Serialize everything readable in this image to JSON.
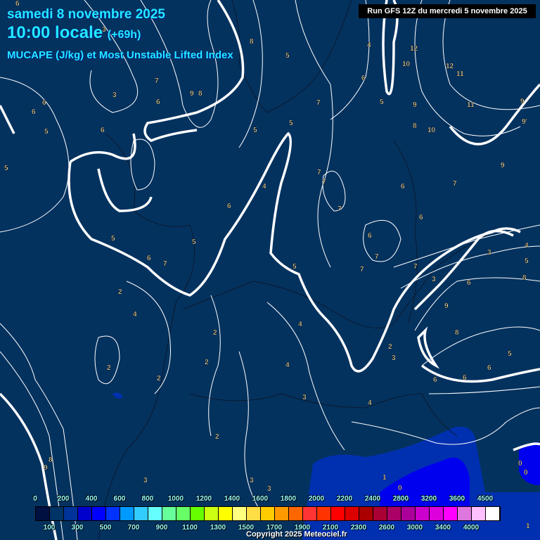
{
  "header": {
    "date": "samedi 8 novembre 2025",
    "time": "10:00 locale",
    "lead": "(+69h)",
    "parameter": "MUCAPE (J/kg) et Most Unstable Lifted Index",
    "run": "Run GFS 12Z du mercredi 5 novembre 2025"
  },
  "colorbar": {
    "colors": [
      "#001040",
      "#003366",
      "#003399",
      "#0000cc",
      "#0000ff",
      "#0033ff",
      "#0099ff",
      "#33ccff",
      "#66ffff",
      "#66ff99",
      "#66ff66",
      "#66ff00",
      "#ccff11",
      "#ffff00",
      "#ffff80",
      "#ffdd44",
      "#ffcc00",
      "#ff9900",
      "#ff6600",
      "#ff3333",
      "#ff3300",
      "#ff0000",
      "#dd0000",
      "#aa0000",
      "#aa0033",
      "#aa0066",
      "#aa0099",
      "#cc00cc",
      "#dd00dd",
      "#ff00ff",
      "#dd77dd",
      "#ffc0ff",
      "#ffffff"
    ],
    "top_labels": [
      "0",
      "200",
      "400",
      "600",
      "800",
      "1000",
      "1200",
      "1400",
      "1600",
      "1800",
      "2000",
      "2200",
      "2400",
      "2800",
      "3200",
      "3600",
      "4500"
    ],
    "bottom_labels": [
      "100",
      "300",
      "500",
      "700",
      "900",
      "1100",
      "1300",
      "1500",
      "1700",
      "1900",
      "2100",
      "2300",
      "2600",
      "3000",
      "3400",
      "4000"
    ]
  },
  "contour_labels": [
    "6",
    "6",
    "3",
    "3",
    "8",
    "7",
    "9",
    "8",
    "6",
    "5",
    "5",
    "7",
    "5",
    "4",
    "6",
    "12",
    "10",
    "12",
    "11",
    "6",
    "9",
    "9",
    "8",
    "10",
    "11",
    "9",
    "9'",
    "5",
    "6",
    "5",
    "7",
    "7",
    "6",
    "7",
    "4",
    "5",
    "6",
    "7",
    "6",
    "5",
    "5",
    "6",
    "7",
    "6",
    "7",
    "7",
    "3",
    "5",
    "4",
    "7",
    "3",
    "6",
    "8",
    "2",
    "4",
    "2",
    "2",
    "2",
    "4",
    "5",
    "4",
    "3",
    "4",
    "2",
    "3",
    "2",
    "6",
    "6",
    "6",
    "2",
    "1",
    "0",
    "0",
    "0",
    "9",
    "8",
    "1",
    "3",
    "3",
    "3",
    "8",
    "5",
    "9"
  ],
  "copyright": "Copyright 2025 Meteociel.fr"
}
